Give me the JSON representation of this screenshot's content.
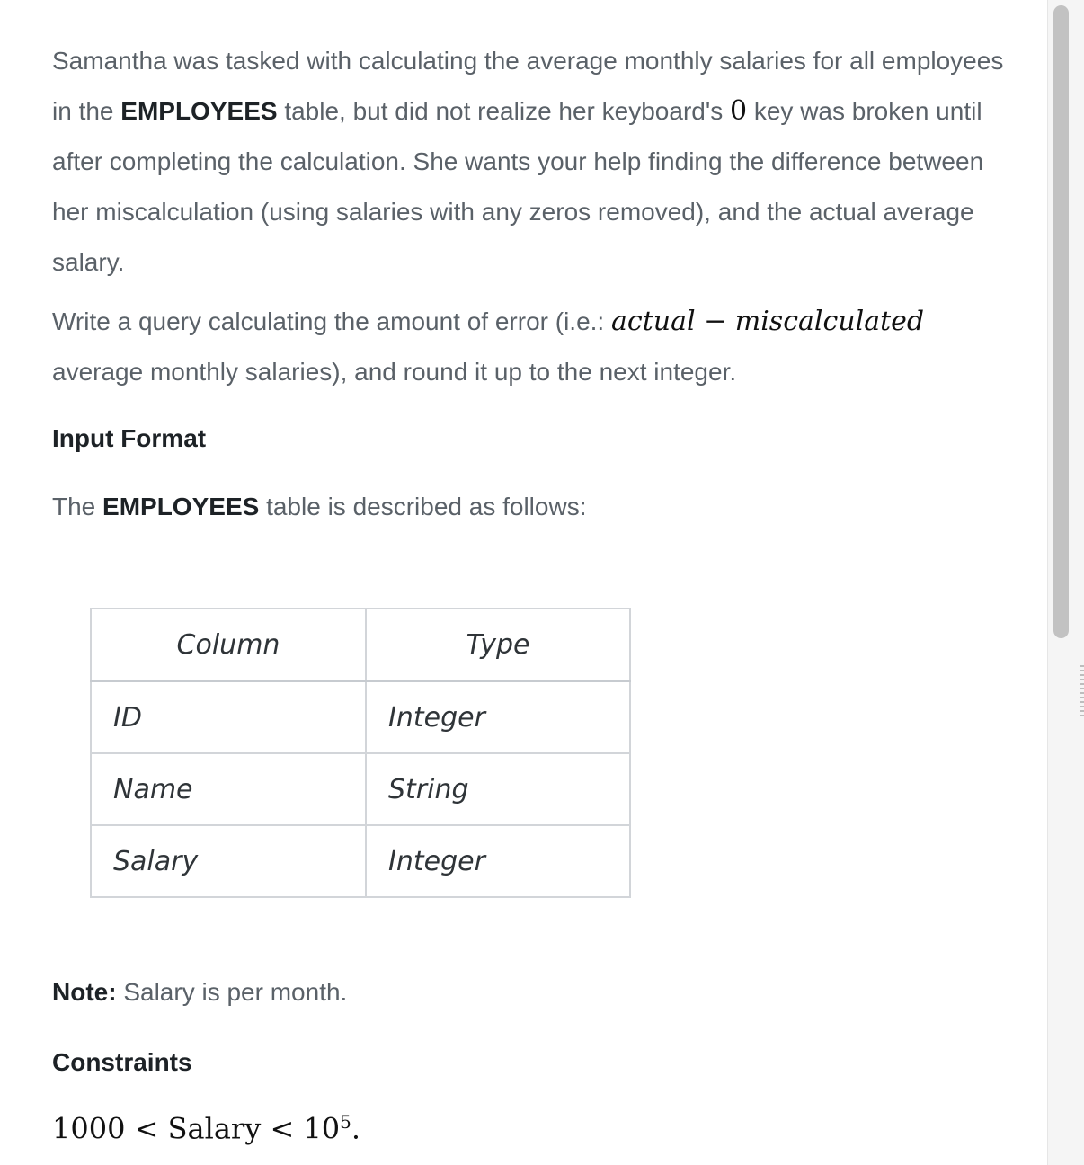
{
  "problem": {
    "para1": {
      "t1": "Samantha was tasked with calculating the average monthly salaries for all employees in the ",
      "table_name": "EMPLOYEES",
      "t2": " table, but did not realize her keyboard's ",
      "zero": "0",
      "t3": " key was broken until after completing the calculation. She wants your help finding the difference between her miscalculation (using salaries with any zeros removed), and the actual average salary."
    },
    "para2": {
      "t1": "Write a query calculating the amount of error (i.e.: ",
      "math": "actual − miscalculated",
      "t2": " average monthly salaries), and round it up to the next integer."
    }
  },
  "input_format": {
    "heading": "Input Format",
    "desc_pre": "The ",
    "desc_table": "EMPLOYEES",
    "desc_post": " table is described as follows:"
  },
  "schema": {
    "headers": [
      "Column",
      "Type"
    ],
    "rows": [
      [
        "ID",
        "Integer"
      ],
      [
        "Name",
        "String"
      ],
      [
        "Salary",
        "Integer"
      ]
    ]
  },
  "note": {
    "label": "Note:",
    "text": " Salary is per month."
  },
  "constraints": {
    "heading": "Constraints",
    "lhs": "1000 < Salary < 10",
    "exponent": "5",
    "end": "."
  }
}
